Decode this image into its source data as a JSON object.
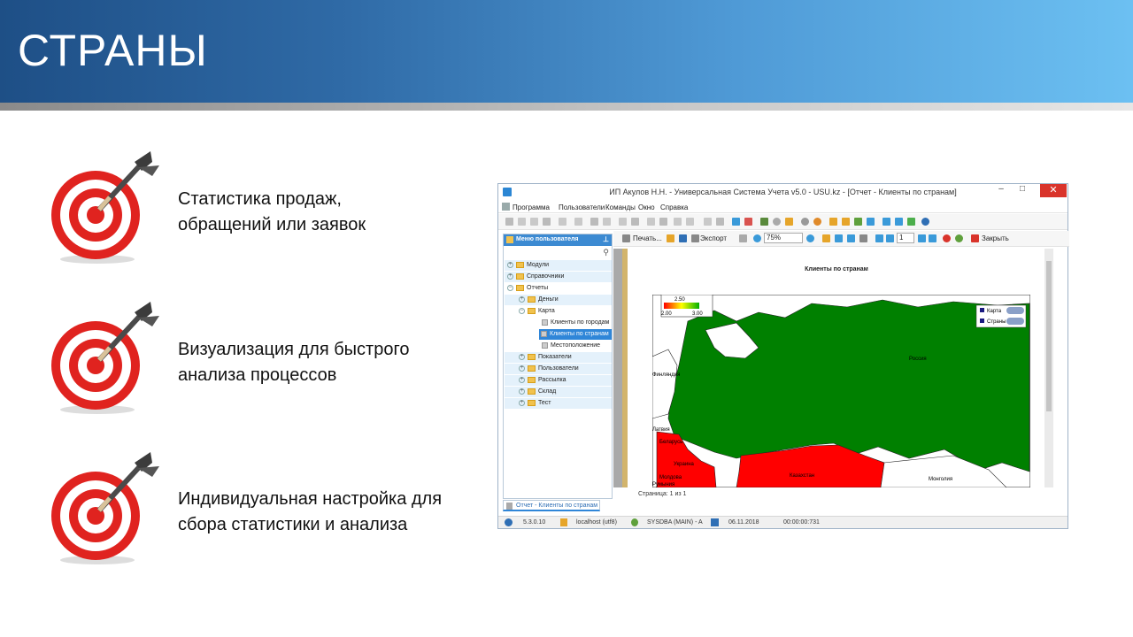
{
  "slide": {
    "title": "СТРАНЫ",
    "bullets": [
      {
        "line1": "Статистика продаж,",
        "line2": "обращений или заявок"
      },
      {
        "line1": "Визуализация для быстрого",
        "line2": "анализа процессов"
      },
      {
        "line1": "Индивидуальная настройка для",
        "line2": "сбора статистики  и анализа"
      }
    ]
  },
  "window": {
    "title": "ИП Акулов Н.Н. - Универсальная Система Учета v5.0 - USU.kz - [Отчет - Клиенты по странам]",
    "controls": {
      "minimize": "–",
      "maximize": "□",
      "close": "✕"
    },
    "menu": [
      "Программа",
      "Пользователи",
      "Команды",
      "Окно",
      "Справка"
    ],
    "report_toolbar": {
      "print": "Печать...",
      "export": "Экспорт",
      "zoom": "75%",
      "page": "1",
      "close": "Закрыть"
    },
    "sidebar": {
      "title": "Меню пользователя",
      "items": [
        {
          "label": "Модули"
        },
        {
          "label": "Справочники"
        },
        {
          "label": "Отчеты"
        },
        {
          "label": "Деньги"
        },
        {
          "label": "Карта"
        },
        {
          "label": "Клиенты по городам"
        },
        {
          "label": "Клиенты по странам"
        },
        {
          "label": "Местоположение"
        },
        {
          "label": "Показатели"
        },
        {
          "label": "Пользователи"
        },
        {
          "label": "Рассылка"
        },
        {
          "label": "Склад"
        },
        {
          "label": "Тест"
        }
      ]
    },
    "report": {
      "title": "Клиенты по странам",
      "scale_mid": "2.50",
      "scale_min": "2.00",
      "scale_max": "3.00",
      "legend": [
        "Карта",
        "Страны"
      ],
      "map_labels": {
        "russia": "Россия",
        "kazakhstan": "Казахстан",
        "mongolia": "Монголия",
        "ukraine": "Украина",
        "belarus": "Беларусь",
        "finland": "Финляндия",
        "latvia": "Латвия",
        "moldova": "Молдова",
        "romania": "Румыния"
      },
      "page_info": "Страница: 1 из 1"
    },
    "doc_tab": "Отчет - Клиенты по странам",
    "status": {
      "version": "5.3.0.10",
      "db": "localhost (utf8)",
      "user": "SYSDBA (MAIN) - A",
      "date": "06.11.2018",
      "timer": "00:00:00:731"
    },
    "colors": {
      "russia": "#008000",
      "highlight": "#ff0000",
      "accent": "#2f86d8"
    }
  }
}
